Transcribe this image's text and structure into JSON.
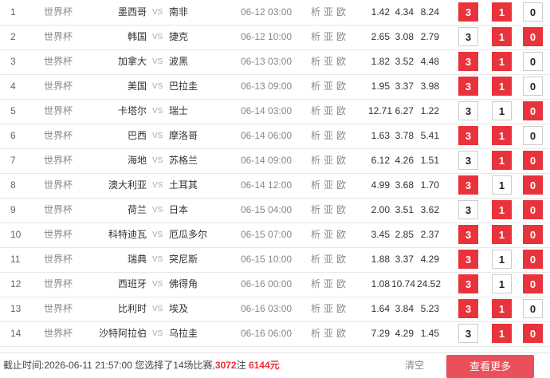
{
  "colors": {
    "accent": "#e8333c",
    "button": "#e8505b"
  },
  "matches": [
    {
      "idx": "1",
      "league": "世界杯",
      "home": "墨西哥",
      "vs": "VS",
      "away": "南非",
      "time": "06-12 03:00",
      "links": [
        "析",
        "亚",
        "欧"
      ],
      "odds": [
        "1.42",
        "4.34",
        "8.24"
      ],
      "picks": [
        {
          "label": "3",
          "on": true
        },
        {
          "label": "1",
          "on": true
        },
        {
          "label": "0",
          "on": false
        }
      ]
    },
    {
      "idx": "2",
      "league": "世界杯",
      "home": "韩国",
      "vs": "VS",
      "away": "捷克",
      "time": "06-12 10:00",
      "links": [
        "析",
        "亚",
        "欧"
      ],
      "odds": [
        "2.65",
        "3.08",
        "2.79"
      ],
      "picks": [
        {
          "label": "3",
          "on": false
        },
        {
          "label": "1",
          "on": true
        },
        {
          "label": "0",
          "on": true
        }
      ]
    },
    {
      "idx": "3",
      "league": "世界杯",
      "home": "加拿大",
      "vs": "VS",
      "away": "波黑",
      "time": "06-13 03:00",
      "links": [
        "析",
        "亚",
        "欧"
      ],
      "odds": [
        "1.82",
        "3.52",
        "4.48"
      ],
      "picks": [
        {
          "label": "3",
          "on": true
        },
        {
          "label": "1",
          "on": true
        },
        {
          "label": "0",
          "on": false
        }
      ]
    },
    {
      "idx": "4",
      "league": "世界杯",
      "home": "美国",
      "vs": "VS",
      "away": "巴拉圭",
      "time": "06-13 09:00",
      "links": [
        "析",
        "亚",
        "欧"
      ],
      "odds": [
        "1.95",
        "3.37",
        "3.98"
      ],
      "picks": [
        {
          "label": "3",
          "on": true
        },
        {
          "label": "1",
          "on": true
        },
        {
          "label": "0",
          "on": false
        }
      ]
    },
    {
      "idx": "5",
      "league": "世界杯",
      "home": "卡塔尔",
      "vs": "VS",
      "away": "瑞士",
      "time": "06-14 03:00",
      "links": [
        "析",
        "亚",
        "欧"
      ],
      "odds": [
        "12.71",
        "6.27",
        "1.22"
      ],
      "picks": [
        {
          "label": "3",
          "on": false
        },
        {
          "label": "1",
          "on": false
        },
        {
          "label": "0",
          "on": true
        }
      ]
    },
    {
      "idx": "6",
      "league": "世界杯",
      "home": "巴西",
      "vs": "VS",
      "away": "摩洛哥",
      "time": "06-14 06:00",
      "links": [
        "析",
        "亚",
        "欧"
      ],
      "odds": [
        "1.63",
        "3.78",
        "5.41"
      ],
      "picks": [
        {
          "label": "3",
          "on": true
        },
        {
          "label": "1",
          "on": true
        },
        {
          "label": "0",
          "on": false
        }
      ]
    },
    {
      "idx": "7",
      "league": "世界杯",
      "home": "海地",
      "vs": "VS",
      "away": "苏格兰",
      "time": "06-14 09:00",
      "links": [
        "析",
        "亚",
        "欧"
      ],
      "odds": [
        "6.12",
        "4.26",
        "1.51"
      ],
      "picks": [
        {
          "label": "3",
          "on": false
        },
        {
          "label": "1",
          "on": true
        },
        {
          "label": "0",
          "on": true
        }
      ]
    },
    {
      "idx": "8",
      "league": "世界杯",
      "home": "澳大利亚",
      "vs": "VS",
      "away": "土耳其",
      "time": "06-14 12:00",
      "links": [
        "析",
        "亚",
        "欧"
      ],
      "odds": [
        "4.99",
        "3.68",
        "1.70"
      ],
      "picks": [
        {
          "label": "3",
          "on": true
        },
        {
          "label": "1",
          "on": false
        },
        {
          "label": "0",
          "on": true
        }
      ]
    },
    {
      "idx": "9",
      "league": "世界杯",
      "home": "荷兰",
      "vs": "VS",
      "away": "日本",
      "time": "06-15 04:00",
      "links": [
        "析",
        "亚",
        "欧"
      ],
      "odds": [
        "2.00",
        "3.51",
        "3.62"
      ],
      "picks": [
        {
          "label": "3",
          "on": false
        },
        {
          "label": "1",
          "on": true
        },
        {
          "label": "0",
          "on": true
        }
      ]
    },
    {
      "idx": "10",
      "league": "世界杯",
      "home": "科特迪瓦",
      "vs": "VS",
      "away": "厄瓜多尔",
      "time": "06-15 07:00",
      "links": [
        "析",
        "亚",
        "欧"
      ],
      "odds": [
        "3.45",
        "2.85",
        "2.37"
      ],
      "picks": [
        {
          "label": "3",
          "on": true
        },
        {
          "label": "1",
          "on": true
        },
        {
          "label": "0",
          "on": true
        }
      ]
    },
    {
      "idx": "11",
      "league": "世界杯",
      "home": "瑞典",
      "vs": "VS",
      "away": "突尼斯",
      "time": "06-15 10:00",
      "links": [
        "析",
        "亚",
        "欧"
      ],
      "odds": [
        "1.88",
        "3.37",
        "4.29"
      ],
      "picks": [
        {
          "label": "3",
          "on": true
        },
        {
          "label": "1",
          "on": false
        },
        {
          "label": "0",
          "on": true
        }
      ]
    },
    {
      "idx": "12",
      "league": "世界杯",
      "home": "西班牙",
      "vs": "VS",
      "away": "佛得角",
      "time": "06-16 00:00",
      "links": [
        "析",
        "亚",
        "欧"
      ],
      "odds": [
        "1.08",
        "10.74",
        "24.52"
      ],
      "picks": [
        {
          "label": "3",
          "on": true
        },
        {
          "label": "1",
          "on": false
        },
        {
          "label": "0",
          "on": true
        }
      ]
    },
    {
      "idx": "13",
      "league": "世界杯",
      "home": "比利时",
      "vs": "VS",
      "away": "埃及",
      "time": "06-16 03:00",
      "links": [
        "析",
        "亚",
        "欧"
      ],
      "odds": [
        "1.64",
        "3.84",
        "5.23"
      ],
      "picks": [
        {
          "label": "3",
          "on": true
        },
        {
          "label": "1",
          "on": true
        },
        {
          "label": "0",
          "on": false
        }
      ]
    },
    {
      "idx": "14",
      "league": "世界杯",
      "home": "沙特阿拉伯",
      "vs": "VS",
      "away": "乌拉圭",
      "time": "06-16 06:00",
      "links": [
        "析",
        "亚",
        "欧"
      ],
      "odds": [
        "7.29",
        "4.29",
        "1.45"
      ],
      "picks": [
        {
          "label": "3",
          "on": false
        },
        {
          "label": "1",
          "on": true
        },
        {
          "label": "0",
          "on": true
        }
      ]
    }
  ],
  "footer": {
    "prefix": "截止时间:2026-06-11 21:57:00 您选择了14场比赛,",
    "bets": "3072",
    "bets_unit": "注 ",
    "amount": "6144元",
    "clear_label": "清空",
    "more_label": "查看更多"
  }
}
